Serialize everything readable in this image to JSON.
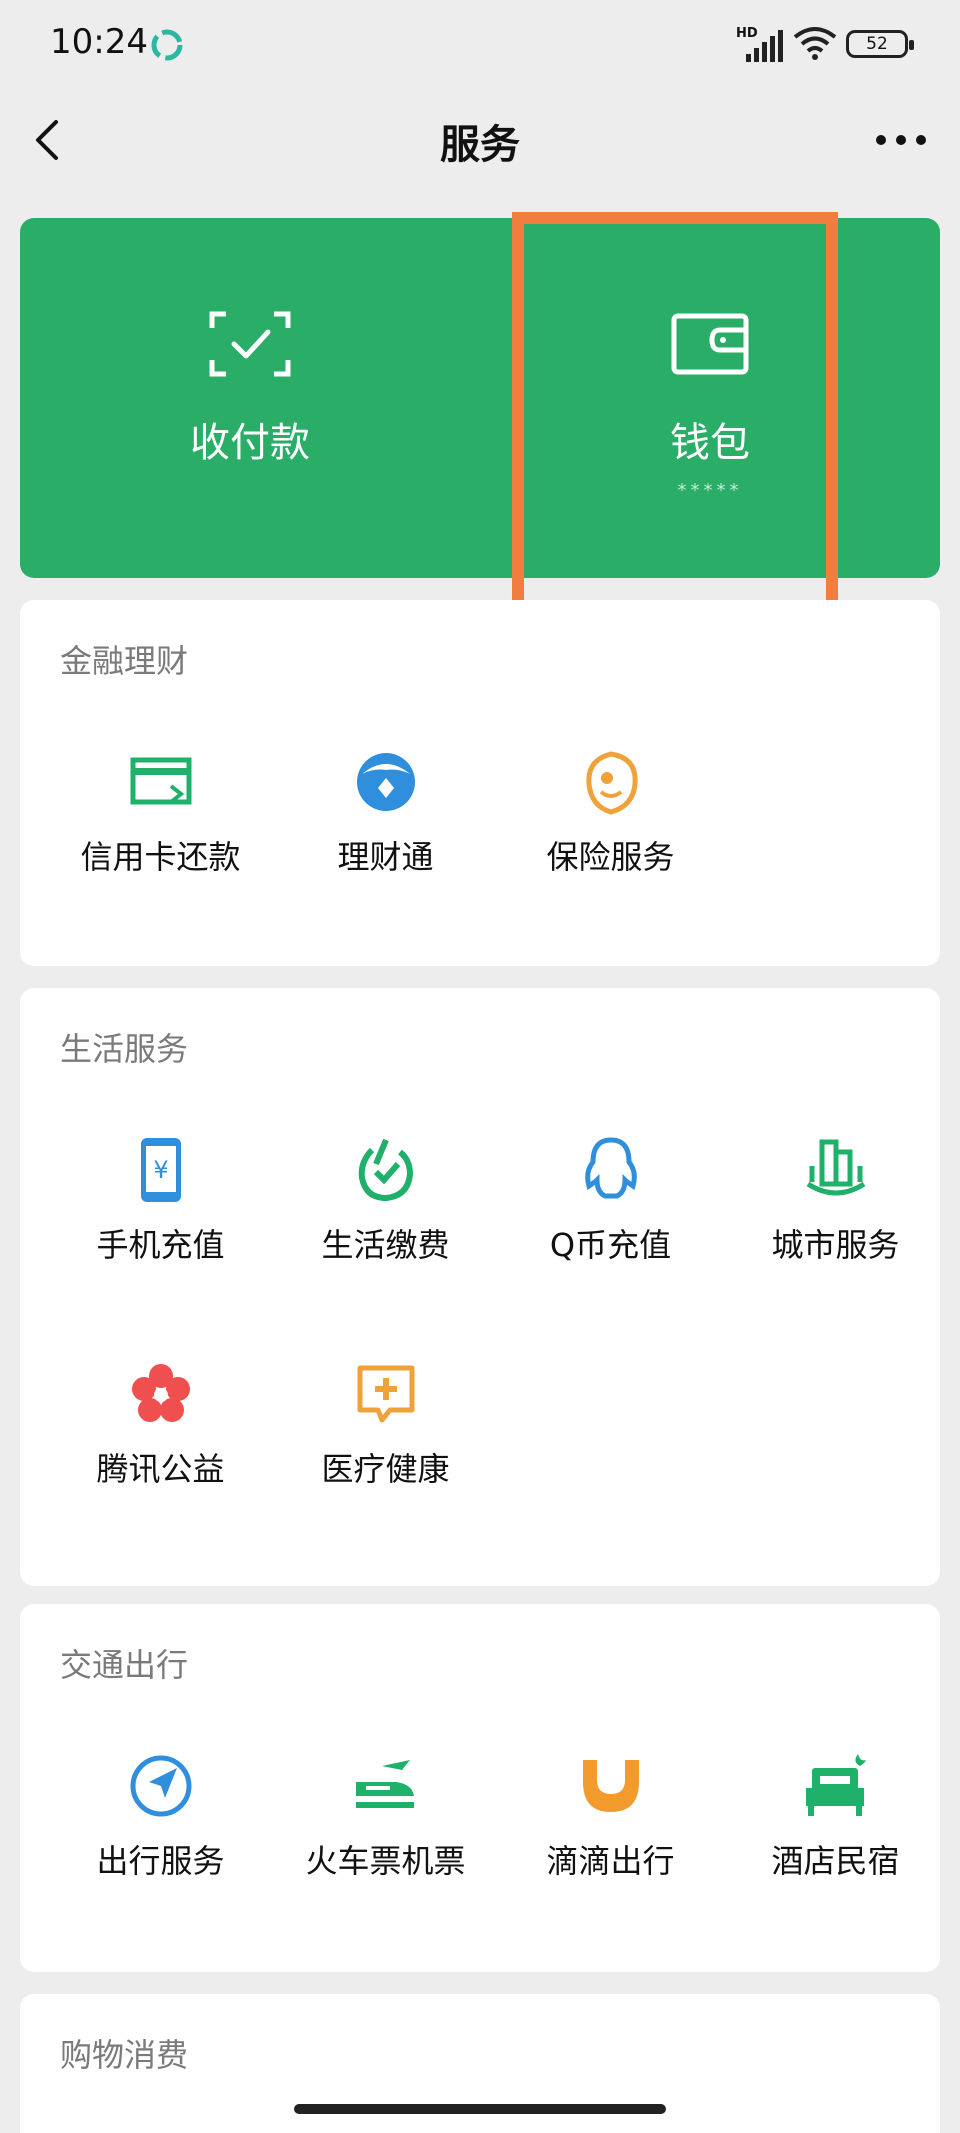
{
  "status_bar": {
    "time": "10:24",
    "network": "HD",
    "battery": "52"
  },
  "nav": {
    "title": "服务"
  },
  "hero": {
    "items": [
      {
        "label": "收付款",
        "icon": "scan-pay-icon"
      },
      {
        "label": "钱包",
        "sub": "*****",
        "icon": "wallet-icon"
      }
    ]
  },
  "sections": [
    {
      "title": "金融理财",
      "items": [
        {
          "label": "信用卡还款",
          "icon": "credit-card-icon"
        },
        {
          "label": "理财通",
          "icon": "wealth-icon"
        },
        {
          "label": "保险服务",
          "icon": "insurance-icon"
        }
      ]
    },
    {
      "title": "生活服务",
      "items": [
        {
          "label": "手机充值",
          "icon": "phone-topup-icon"
        },
        {
          "label": "生活缴费",
          "icon": "utility-bill-icon"
        },
        {
          "label": "Q币充值",
          "icon": "qq-coin-icon"
        },
        {
          "label": "城市服务",
          "icon": "city-service-icon"
        },
        {
          "label": "腾讯公益",
          "icon": "charity-flower-icon"
        },
        {
          "label": "医疗健康",
          "icon": "medical-icon"
        }
      ]
    },
    {
      "title": "交通出行",
      "items": [
        {
          "label": "出行服务",
          "icon": "navigation-icon"
        },
        {
          "label": "火车票机票",
          "icon": "train-plane-icon"
        },
        {
          "label": "滴滴出行",
          "icon": "didi-icon"
        },
        {
          "label": "酒店民宿",
          "icon": "hotel-bed-icon"
        }
      ]
    },
    {
      "title": "购物消费",
      "items": []
    }
  ],
  "colors": {
    "brand_green": "#2aae67",
    "highlight": "#f27d3f",
    "background": "#ededed"
  }
}
